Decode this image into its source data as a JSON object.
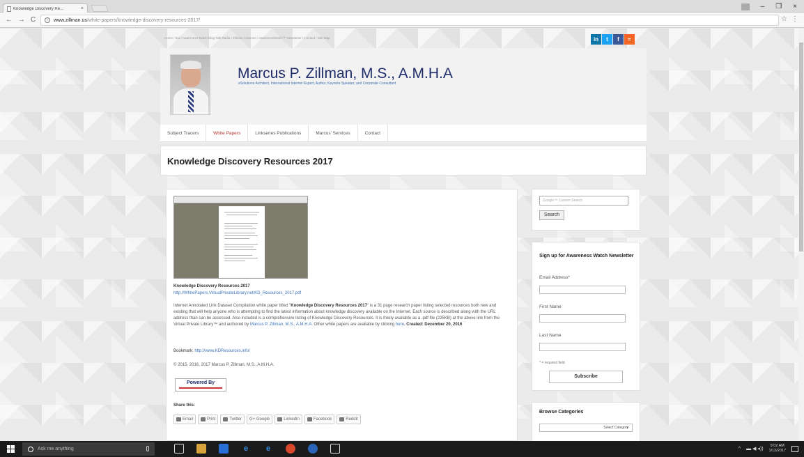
{
  "browser": {
    "tab_title": "Knowledge Discovery Re...",
    "tab_close": "×",
    "url_host": "www.zillman.us",
    "url_path": "/white-papers/knowledge-discovery-resources-2017/",
    "nav_back": "←",
    "nav_forward": "→",
    "nav_reload": "C",
    "star": "☆",
    "menu": "⋮",
    "win_min": "–",
    "win_max": "❐",
    "win_close": "×"
  },
  "site": {
    "top_menu": "Home / Bio / Awareness Watch Blog Talk Radio / Zillman Columns / AwarenessWatch™ Newsletter / Contact / Site Map",
    "title": "Marcus P. Zillman, M.S., A.M.H.A",
    "tagline": "eSolutions Architect, International Internet Expert, Author, Keynote Speaker, and Corporate Consultant",
    "social": {
      "linkedin": "in",
      "twitter": "t",
      "facebook": "f",
      "rss": "≈"
    },
    "nav": [
      "Subject Tracers",
      "White Papers",
      "Linkseries Publications",
      "Marcus' Services",
      "Contact"
    ]
  },
  "page": {
    "title": "Knowledge Discovery Resources 2017"
  },
  "article": {
    "doc_title": "Knowledge Discovery Resources 2017",
    "doc_url": "http://WhitePapers.VirtualPrivateLibrary.net/KD_Resources_2017.pdf",
    "desc_intro": "Internet Annotated Link Dataset Compilation white paper titled \"",
    "desc_bold_title": "Knowledge Discovery Resources 2017",
    "desc_mid": "\" is a 31 page research paper listing selected resources both new and existing that will help anyone who is attempting to find the latest information about knowledge discovery available on the Internet. Each source is described along with the URL address than can be accessed. Also included is a comprehensive listing of Knowledge Discovery Resources. It is freely available as a .pdf file (225KB) at the above link from the Virtual Private Library™ and authored by ",
    "desc_author": "Marcus P. Zillman, M.S., A.M.H.A.",
    "desc_other": " Other white papers are available by clicking ",
    "desc_here": "here",
    "desc_created": ". Created: December 20, 2016",
    "bookmark_label": "Bookmark: ",
    "bookmark_url": "http://www.KDResources.info/",
    "copyright": "© 2015, 2016, 2017 Marcus P. Zillman, M.S., A.M.H.A.",
    "powered_by": "Powered By",
    "share_label": "Share this:",
    "share_buttons": [
      "Email",
      "Print",
      "Twitter",
      "G+ Google",
      "LinkedIn",
      "Facebook",
      "Reddit"
    ]
  },
  "sidebar": {
    "search_placeholder": "Google™ Custom Search",
    "search_button": "Search",
    "newsletter_title": "Sign up for Awareness Watch Newsletter",
    "email_label": "Email Address*",
    "first_name_label": "First Name",
    "last_name_label": "Last Name",
    "required_note": "* = required field",
    "subscribe_button": "Subscribe",
    "categories_title": "Browse Categories",
    "categories_select": "Select Category"
  },
  "taskbar": {
    "search_text": "Ask me anything",
    "clock_time": "9:02 AM",
    "clock_date": "1/12/2017",
    "tray_chevron": "^",
    "tray_icons": "▬ ◀ ◂))"
  },
  "colors": {
    "title_blue": "#1f2d6b",
    "link_blue": "#3b73b9",
    "active_nav_red": "#b22d2d"
  }
}
